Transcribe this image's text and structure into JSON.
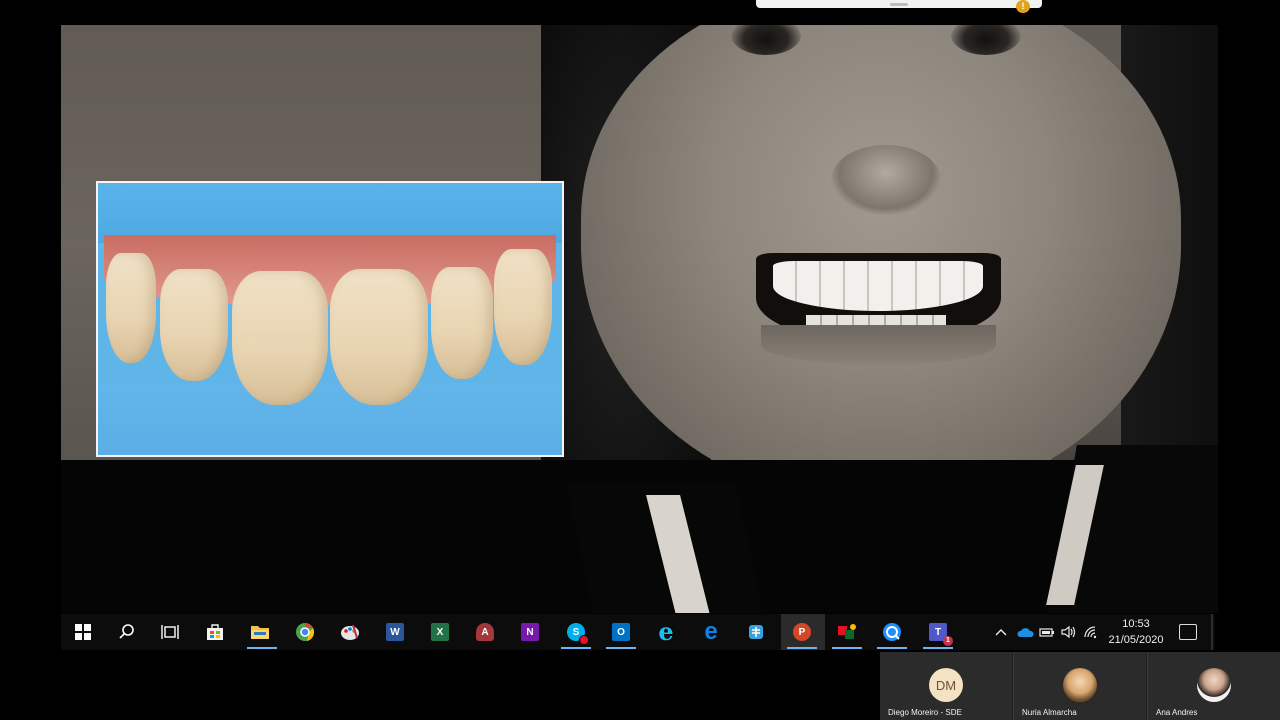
{
  "slide": {
    "main_image": "smiling-woman-portrait-sepia",
    "inset_image": "dental-veneers-closeup"
  },
  "overlay": {
    "warning_icon": "warning-icon"
  },
  "taskbar": {
    "icons": [
      {
        "name": "start-icon",
        "color": "#ffffff"
      },
      {
        "name": "search-icon",
        "color": "#ffffff"
      },
      {
        "name": "task-view-icon",
        "color": "#ffffff"
      },
      {
        "name": "store-icon",
        "color": "#0078d4"
      },
      {
        "name": "file-explorer-icon",
        "color": "#f5c242"
      },
      {
        "name": "chrome-icon",
        "color": "#4285f4"
      },
      {
        "name": "paint-icon",
        "color": "#e6e6e6"
      },
      {
        "name": "word-icon",
        "color": "#2b579a",
        "letter": "W"
      },
      {
        "name": "excel-icon",
        "color": "#217346",
        "letter": "X"
      },
      {
        "name": "access-icon",
        "color": "#a4373a",
        "letter": "A"
      },
      {
        "name": "onenote-icon",
        "color": "#7719aa",
        "letter": "N"
      },
      {
        "name": "skype-icon",
        "color": "#00aff0",
        "letter": "S"
      },
      {
        "name": "outlook-icon",
        "color": "#0072c6",
        "letter": "O"
      },
      {
        "name": "internet-explorer-icon",
        "color": "#1ebbee",
        "letter": "e"
      },
      {
        "name": "edge-icon",
        "color": "#0078d7",
        "letter": "e"
      },
      {
        "name": "settings-app-icon",
        "color": "#3aa0e0"
      },
      {
        "name": "powerpoint-icon",
        "color": "#d24726",
        "letter": "P"
      },
      {
        "name": "media-app-icon",
        "color": "#e81123"
      },
      {
        "name": "remote-assist-icon",
        "color": "#1e90ff"
      },
      {
        "name": "teams-icon",
        "color": "#5059c9",
        "letter": "T"
      }
    ],
    "clock": {
      "time": "10:53",
      "date": "21/05/2020"
    }
  },
  "participants": [
    {
      "initials": "DM",
      "name": "Diego Moreiro - SDE"
    },
    {
      "initials": "",
      "name": "Nuria Almarcha"
    },
    {
      "initials": "",
      "name": "Ana Andres"
    }
  ]
}
